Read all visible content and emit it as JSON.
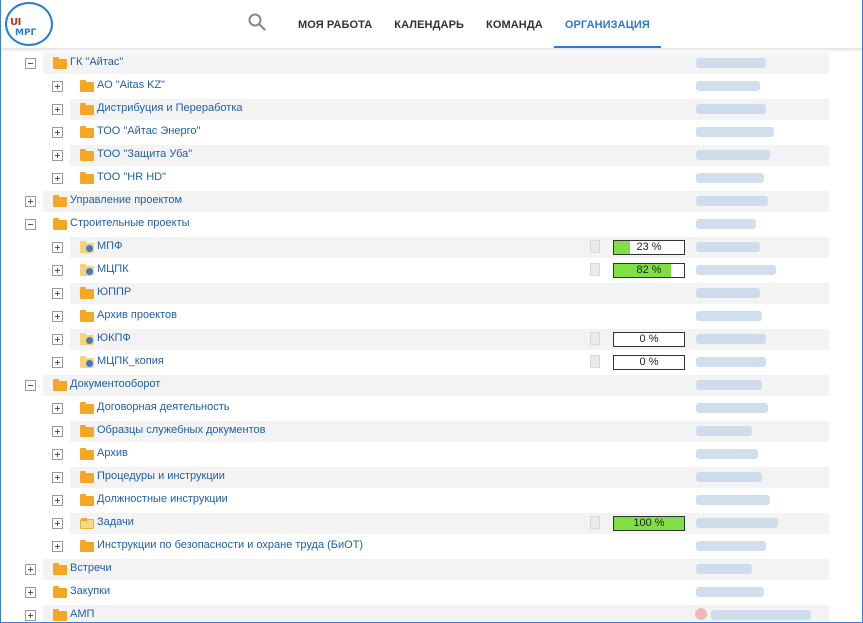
{
  "header": {
    "logo_text": "МРГ",
    "logo_initials": "UI",
    "nav": [
      {
        "label": "МОЯ РАБОТА",
        "active": false
      },
      {
        "label": "КАЛЕНДАРЬ",
        "active": false
      },
      {
        "label": "КОМАНДА",
        "active": false
      },
      {
        "label": "ОРГАНИЗАЦИЯ",
        "active": true
      }
    ]
  },
  "tree": [
    {
      "label": "ГК \"Айтас\"",
      "level": 0,
      "expanded": true,
      "folder": "plain"
    },
    {
      "label": "АО \"Aitas KZ\"",
      "level": 1,
      "expanded": false,
      "folder": "plain"
    },
    {
      "label": "Дистрибуция и Переработка",
      "level": 1,
      "expanded": false,
      "folder": "plain"
    },
    {
      "label": "ТОО \"Айтас Энерго\"",
      "level": 1,
      "expanded": false,
      "folder": "plain"
    },
    {
      "label": "ТОО \"Защита Уба\"",
      "level": 1,
      "expanded": false,
      "folder": "plain"
    },
    {
      "label": "ТОО \"HR HD\"",
      "level": 1,
      "expanded": false,
      "folder": "plain"
    },
    {
      "label": "Управление проектом",
      "level": 0,
      "expanded": false,
      "folder": "plain"
    },
    {
      "label": "Строительные проекты",
      "level": 0,
      "expanded": true,
      "folder": "plain"
    },
    {
      "label": "МПФ",
      "level": 1,
      "expanded": false,
      "folder": "proj",
      "progress": 0.23,
      "progress_label": "23 %"
    },
    {
      "label": "МЦПК",
      "level": 1,
      "expanded": false,
      "folder": "proj",
      "progress": 0.82,
      "progress_label": "82 %"
    },
    {
      "label": "ЮППР",
      "level": 1,
      "expanded": false,
      "folder": "plain"
    },
    {
      "label": "Архив проектов",
      "level": 1,
      "expanded": false,
      "folder": "plain"
    },
    {
      "label": "ЮКПФ",
      "level": 1,
      "expanded": false,
      "folder": "proj",
      "progress": 0,
      "progress_label": "0 %"
    },
    {
      "label": "МЦПК_копия",
      "level": 1,
      "expanded": false,
      "folder": "proj",
      "progress": 0,
      "progress_label": "0 %"
    },
    {
      "label": "Документооборот",
      "level": 0,
      "expanded": true,
      "folder": "plain"
    },
    {
      "label": "Договорная деятельность",
      "level": 1,
      "expanded": false,
      "folder": "plain"
    },
    {
      "label": "Образцы служебных документов",
      "level": 1,
      "expanded": false,
      "folder": "plain"
    },
    {
      "label": "Архив",
      "level": 1,
      "expanded": false,
      "folder": "plain"
    },
    {
      "label": "Процедуры и инструкции",
      "level": 1,
      "expanded": false,
      "folder": "plain"
    },
    {
      "label": "Должностные инструкции",
      "level": 1,
      "expanded": false,
      "folder": "plain"
    },
    {
      "label": "Задачи",
      "level": 1,
      "expanded": false,
      "folder": "open",
      "progress": 1.0,
      "progress_label": "100 %"
    },
    {
      "label": "Инструкции по безопасности и охране труда (БиОТ)",
      "level": 1,
      "expanded": false,
      "folder": "plain"
    },
    {
      "label": "Встречи",
      "level": 0,
      "expanded": false,
      "folder": "plain"
    },
    {
      "label": "Закупки",
      "level": 0,
      "expanded": false,
      "folder": "plain"
    },
    {
      "label": "АМП",
      "level": 0,
      "expanded": false,
      "folder": "plain",
      "avatar": true
    }
  ],
  "colors": {
    "accent": "#2a7bd4",
    "progress_fill": "#7ee043",
    "folder": "#f5a623"
  }
}
